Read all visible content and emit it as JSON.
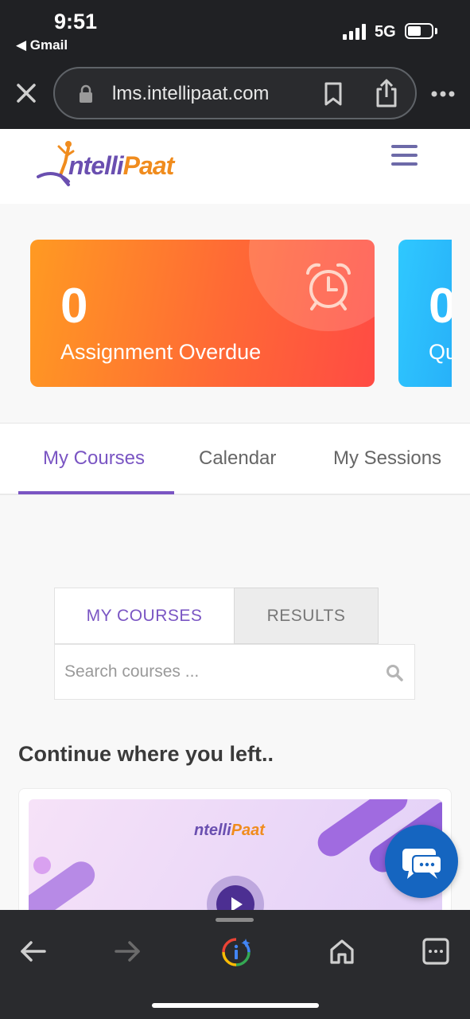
{
  "status_bar": {
    "time": "9:51",
    "back_app": "◀ Gmail",
    "network": "5G"
  },
  "browser": {
    "url": "lms.intellipaat.com",
    "icons": [
      "close-icon",
      "lock-icon",
      "bookmark-icon",
      "share-icon",
      "more-icon"
    ]
  },
  "site": {
    "logo_part1": "ntelli",
    "logo_part2": "Paat",
    "brand_colors": {
      "purple": "#6a4fb0",
      "orange": "#f08c1e"
    }
  },
  "stats": [
    {
      "value": "0",
      "label": "Assignment Overdue",
      "icon": "alarm-clock-icon"
    },
    {
      "value": "0",
      "label": "Qu"
    }
  ],
  "main_tabs": [
    {
      "label": "My Courses",
      "active": true
    },
    {
      "label": "Calendar",
      "active": false
    },
    {
      "label": "My Sessions",
      "active": false
    }
  ],
  "sub_tabs": [
    {
      "label": "MY COURSES",
      "active": true
    },
    {
      "label": "RESULTS",
      "active": false
    }
  ],
  "search": {
    "placeholder": "Search courses ..."
  },
  "continue_section": {
    "title": "Continue where you left..",
    "thumb_logo_part1": "ntelli",
    "thumb_logo_part2": "Paat"
  },
  "colors": {
    "accent": "#7a55c3",
    "chat": "#1565c0"
  }
}
